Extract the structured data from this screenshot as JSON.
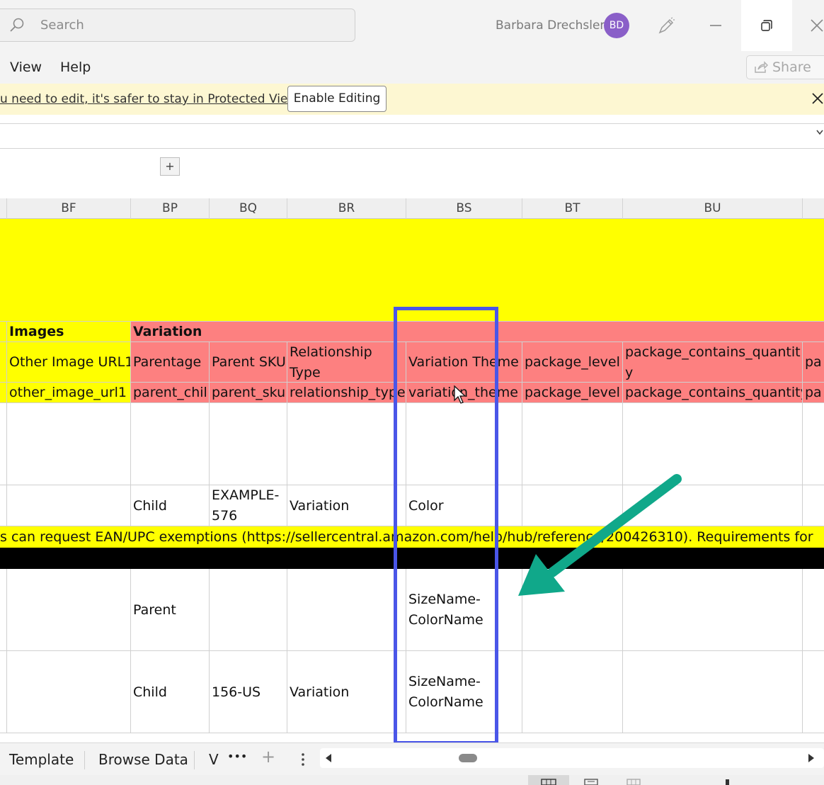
{
  "titlebar": {
    "search_placeholder": "Search",
    "user_name": "Barbara Drechsler",
    "avatar_initials": "BD"
  },
  "menu": {
    "items": [
      "View",
      "Help"
    ],
    "share_label": "Share"
  },
  "protected_view": {
    "message": "u need to edit, it's safer to stay in Protected View.",
    "button_label": "Enable Editing"
  },
  "grid": {
    "columns": [
      "BF",
      "BP",
      "BQ",
      "BR",
      "BS",
      "BT",
      "BU"
    ],
    "section_headers": {
      "images": "Images",
      "variation": "Variation"
    },
    "label_row": [
      "Other Image URL1",
      "Parentage",
      "Parent SKU",
      "Relationship Type",
      "Variation Theme",
      "package_level",
      "package_contains_quantity",
      "pa"
    ],
    "field_row": [
      "other_image_url1",
      "parent_chil",
      "parent_sku",
      "relationship_type",
      "variation_theme",
      "package_level",
      "package_contains_quantity",
      "pa"
    ],
    "rows": [
      {
        "parentage": "Child",
        "parent_sku": "EXAMPLE-576",
        "relationship": "Variation",
        "theme": "Color"
      },
      {
        "parentage": "Parent",
        "parent_sku": "",
        "relationship": "",
        "theme": "SizeName-ColorName"
      },
      {
        "parentage": "Child",
        "parent_sku": "156-US",
        "relationship": "Variation",
        "theme": "SizeName-ColorName"
      }
    ],
    "note_text": "s can request EAN/UPC exemptions (https://sellercentral.amazon.com/help/hub/reference/200426310).        Requirements for"
  },
  "sheet_tabs": {
    "tabs": [
      "Template",
      "Browse Data",
      "V"
    ],
    "more": "•••",
    "add": "+"
  },
  "colors": {
    "yellow": "#ffff00",
    "salmon": "#fd8080",
    "highlight": "#4a56e8",
    "arrow": "#10a88a"
  }
}
